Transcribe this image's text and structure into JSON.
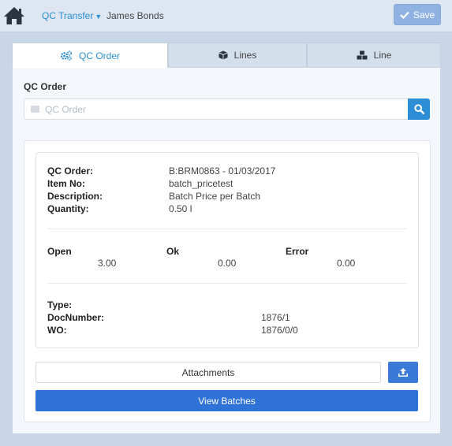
{
  "header": {
    "module": "QC Transfer",
    "user": "James Bonds",
    "save_label": "Save"
  },
  "tabs": [
    {
      "label": "QC Order",
      "icon": "gears-icon",
      "active": true
    },
    {
      "label": "Lines",
      "icon": "cube-icon",
      "active": false
    },
    {
      "label": "Line",
      "icon": "cubes-icon",
      "active": false
    }
  ],
  "form": {
    "title": "QC Order",
    "search_placeholder": "QC Order",
    "search_value": ""
  },
  "details": {
    "qc_order_label": "QC Order:",
    "qc_order_value": "B:BRM0863 - 01/03/2017",
    "item_no_label": "Item No:",
    "item_no_value": "batch_pricetest",
    "description_label": "Description:",
    "description_value": "Batch Price per Batch",
    "quantity_label": "Quantity:",
    "quantity_value": "0.50 l"
  },
  "counts": {
    "open_label": "Open",
    "open_value": "3.00",
    "ok_label": "Ok",
    "ok_value": "0.00",
    "error_label": "Error",
    "error_value": "0.00"
  },
  "doc": {
    "type_label": "Type:",
    "type_value": "",
    "docnumber_label": "DocNumber:",
    "docnumber_value": "1876/1",
    "wo_label": "WO:",
    "wo_value": "1876/0/0"
  },
  "actions": {
    "attachments_label": "Attachments",
    "view_batches_label": "View Batches"
  },
  "colors": {
    "accent": "#2c8fd6",
    "primary_button": "#2f72d8",
    "save_disabled": "#8fb2e2",
    "background": "#c8d6e8"
  }
}
